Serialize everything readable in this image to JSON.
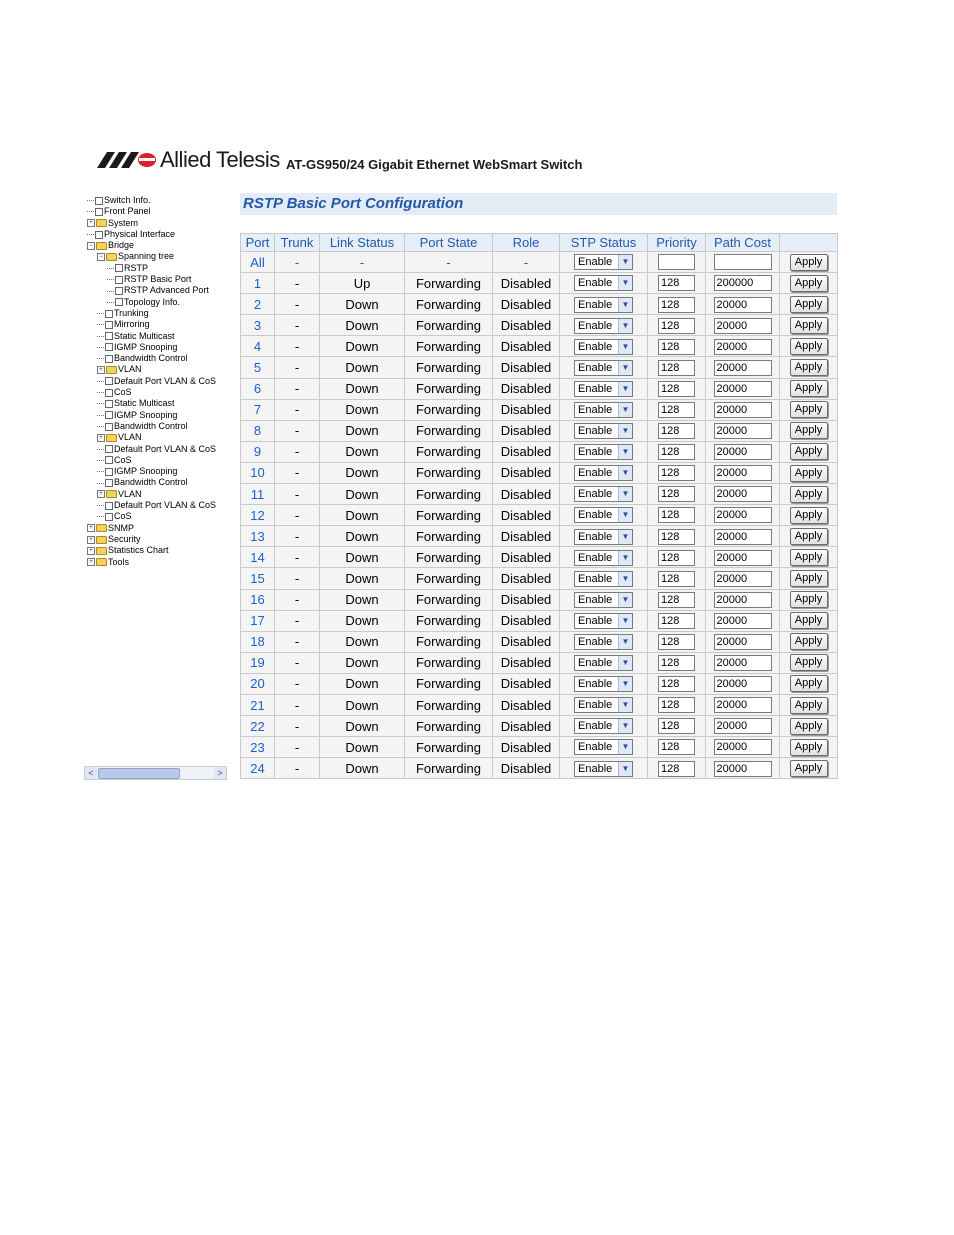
{
  "header": {
    "brand": "Allied Telesis",
    "product": "AT-GS950/24 Gigabit Ethernet WebSmart Switch"
  },
  "tree": [
    {
      "label": "Switch Info.",
      "level": 0,
      "type": "doc"
    },
    {
      "label": "Front Panel",
      "level": 0,
      "type": "doc"
    },
    {
      "label": "System",
      "level": 0,
      "type": "folder",
      "toggle": "+"
    },
    {
      "label": "Physical Interface",
      "level": 0,
      "type": "doc"
    },
    {
      "label": "Bridge",
      "level": 0,
      "type": "folder",
      "toggle": "−"
    },
    {
      "label": "Spanning tree",
      "level": 1,
      "type": "folder",
      "toggle": "−"
    },
    {
      "label": "RSTP",
      "level": 2,
      "type": "doc"
    },
    {
      "label": "RSTP Basic Port",
      "level": 2,
      "type": "doc"
    },
    {
      "label": "RSTP Advanced Port",
      "level": 2,
      "type": "doc"
    },
    {
      "label": "Topology Info.",
      "level": 2,
      "type": "doc"
    },
    {
      "label": "Trunking",
      "level": 1,
      "type": "doc"
    },
    {
      "label": "Mirroring",
      "level": 1,
      "type": "doc"
    },
    {
      "label": "Static Multicast",
      "level": 1,
      "type": "doc"
    },
    {
      "label": "IGMP Snooping",
      "level": 1,
      "type": "doc"
    },
    {
      "label": "Bandwidth Control",
      "level": 1,
      "type": "doc"
    },
    {
      "label": "VLAN",
      "level": 1,
      "type": "folder",
      "toggle": "+"
    },
    {
      "label": "Default Port VLAN & CoS",
      "level": 1,
      "type": "doc"
    },
    {
      "label": "CoS",
      "level": 1,
      "type": "doc"
    },
    {
      "label": "Static Multicast",
      "level": 1,
      "type": "doc"
    },
    {
      "label": "IGMP Snooping",
      "level": 1,
      "type": "doc"
    },
    {
      "label": "Bandwidth Control",
      "level": 1,
      "type": "doc"
    },
    {
      "label": "VLAN",
      "level": 1,
      "type": "folder",
      "toggle": "+"
    },
    {
      "label": "Default Port VLAN & CoS",
      "level": 1,
      "type": "doc"
    },
    {
      "label": "CoS",
      "level": 1,
      "type": "doc"
    },
    {
      "label": "IGMP Snooping",
      "level": 1,
      "type": "doc"
    },
    {
      "label": "Bandwidth Control",
      "level": 1,
      "type": "doc"
    },
    {
      "label": "VLAN",
      "level": 1,
      "type": "folder",
      "toggle": "+"
    },
    {
      "label": "Default Port VLAN & CoS",
      "level": 1,
      "type": "doc"
    },
    {
      "label": "CoS",
      "level": 1,
      "type": "doc"
    },
    {
      "label": "SNMP",
      "level": 0,
      "type": "folder",
      "toggle": "+"
    },
    {
      "label": "Security",
      "level": 0,
      "type": "folder",
      "toggle": "+"
    },
    {
      "label": "Statistics Chart",
      "level": 0,
      "type": "folder",
      "toggle": "+"
    },
    {
      "label": "Tools",
      "level": 0,
      "type": "folder",
      "toggle": "+"
    }
  ],
  "scrollbar": {
    "left": "<",
    "right": ">"
  },
  "panel": {
    "title": "RSTP Basic Port Configuration",
    "columns": [
      "Port",
      "Trunk",
      "Link Status",
      "Port State",
      "Role",
      "STP Status",
      "Priority",
      "Path Cost",
      ""
    ],
    "apply_label": "Apply",
    "all_row": {
      "port": "All",
      "trunk": "-",
      "link": "-",
      "state": "-",
      "role": "-",
      "stp": "Enable",
      "priority": "",
      "cost": ""
    },
    "rows": [
      {
        "port": "1",
        "trunk": "-",
        "link": "Up",
        "state": "Forwarding",
        "role": "Disabled",
        "stp": "Enable",
        "priority": "128",
        "cost": "200000"
      },
      {
        "port": "2",
        "trunk": "-",
        "link": "Down",
        "state": "Forwarding",
        "role": "Disabled",
        "stp": "Enable",
        "priority": "128",
        "cost": "20000"
      },
      {
        "port": "3",
        "trunk": "-",
        "link": "Down",
        "state": "Forwarding",
        "role": "Disabled",
        "stp": "Enable",
        "priority": "128",
        "cost": "20000"
      },
      {
        "port": "4",
        "trunk": "-",
        "link": "Down",
        "state": "Forwarding",
        "role": "Disabled",
        "stp": "Enable",
        "priority": "128",
        "cost": "20000"
      },
      {
        "port": "5",
        "trunk": "-",
        "link": "Down",
        "state": "Forwarding",
        "role": "Disabled",
        "stp": "Enable",
        "priority": "128",
        "cost": "20000"
      },
      {
        "port": "6",
        "trunk": "-",
        "link": "Down",
        "state": "Forwarding",
        "role": "Disabled",
        "stp": "Enable",
        "priority": "128",
        "cost": "20000"
      },
      {
        "port": "7",
        "trunk": "-",
        "link": "Down",
        "state": "Forwarding",
        "role": "Disabled",
        "stp": "Enable",
        "priority": "128",
        "cost": "20000"
      },
      {
        "port": "8",
        "trunk": "-",
        "link": "Down",
        "state": "Forwarding",
        "role": "Disabled",
        "stp": "Enable",
        "priority": "128",
        "cost": "20000"
      },
      {
        "port": "9",
        "trunk": "-",
        "link": "Down",
        "state": "Forwarding",
        "role": "Disabled",
        "stp": "Enable",
        "priority": "128",
        "cost": "20000"
      },
      {
        "port": "10",
        "trunk": "-",
        "link": "Down",
        "state": "Forwarding",
        "role": "Disabled",
        "stp": "Enable",
        "priority": "128",
        "cost": "20000"
      },
      {
        "port": "11",
        "trunk": "-",
        "link": "Down",
        "state": "Forwarding",
        "role": "Disabled",
        "stp": "Enable",
        "priority": "128",
        "cost": "20000"
      },
      {
        "port": "12",
        "trunk": "-",
        "link": "Down",
        "state": "Forwarding",
        "role": "Disabled",
        "stp": "Enable",
        "priority": "128",
        "cost": "20000"
      },
      {
        "port": "13",
        "trunk": "-",
        "link": "Down",
        "state": "Forwarding",
        "role": "Disabled",
        "stp": "Enable",
        "priority": "128",
        "cost": "20000"
      },
      {
        "port": "14",
        "trunk": "-",
        "link": "Down",
        "state": "Forwarding",
        "role": "Disabled",
        "stp": "Enable",
        "priority": "128",
        "cost": "20000"
      },
      {
        "port": "15",
        "trunk": "-",
        "link": "Down",
        "state": "Forwarding",
        "role": "Disabled",
        "stp": "Enable",
        "priority": "128",
        "cost": "20000"
      },
      {
        "port": "16",
        "trunk": "-",
        "link": "Down",
        "state": "Forwarding",
        "role": "Disabled",
        "stp": "Enable",
        "priority": "128",
        "cost": "20000"
      },
      {
        "port": "17",
        "trunk": "-",
        "link": "Down",
        "state": "Forwarding",
        "role": "Disabled",
        "stp": "Enable",
        "priority": "128",
        "cost": "20000"
      },
      {
        "port": "18",
        "trunk": "-",
        "link": "Down",
        "state": "Forwarding",
        "role": "Disabled",
        "stp": "Enable",
        "priority": "128",
        "cost": "20000"
      },
      {
        "port": "19",
        "trunk": "-",
        "link": "Down",
        "state": "Forwarding",
        "role": "Disabled",
        "stp": "Enable",
        "priority": "128",
        "cost": "20000"
      },
      {
        "port": "20",
        "trunk": "-",
        "link": "Down",
        "state": "Forwarding",
        "role": "Disabled",
        "stp": "Enable",
        "priority": "128",
        "cost": "20000"
      },
      {
        "port": "21",
        "trunk": "-",
        "link": "Down",
        "state": "Forwarding",
        "role": "Disabled",
        "stp": "Enable",
        "priority": "128",
        "cost": "20000"
      },
      {
        "port": "22",
        "trunk": "-",
        "link": "Down",
        "state": "Forwarding",
        "role": "Disabled",
        "stp": "Enable",
        "priority": "128",
        "cost": "20000"
      },
      {
        "port": "23",
        "trunk": "-",
        "link": "Down",
        "state": "Forwarding",
        "role": "Disabled",
        "stp": "Enable",
        "priority": "128",
        "cost": "20000"
      },
      {
        "port": "24",
        "trunk": "-",
        "link": "Down",
        "state": "Forwarding",
        "role": "Disabled",
        "stp": "Enable",
        "priority": "128",
        "cost": "20000"
      }
    ]
  },
  "colors": {
    "accent": "#2458a8",
    "header_bg": "#e6eefa",
    "logo_red": "#d8232a"
  }
}
